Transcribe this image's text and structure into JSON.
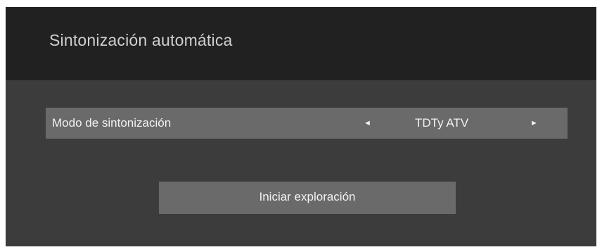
{
  "header": {
    "title": "Sintonización automática"
  },
  "tuning_mode": {
    "label": "Modo de sintonización",
    "value": "TDTy ATV",
    "left_arrow": "◄",
    "right_arrow": "►"
  },
  "actions": {
    "start_scan_label": "Iniciar exploración"
  },
  "colors": {
    "header_bg": "#212121",
    "body_bg": "#3c3c3c",
    "row_bg": "#6a6a6a",
    "text": "#f2f2f2"
  }
}
